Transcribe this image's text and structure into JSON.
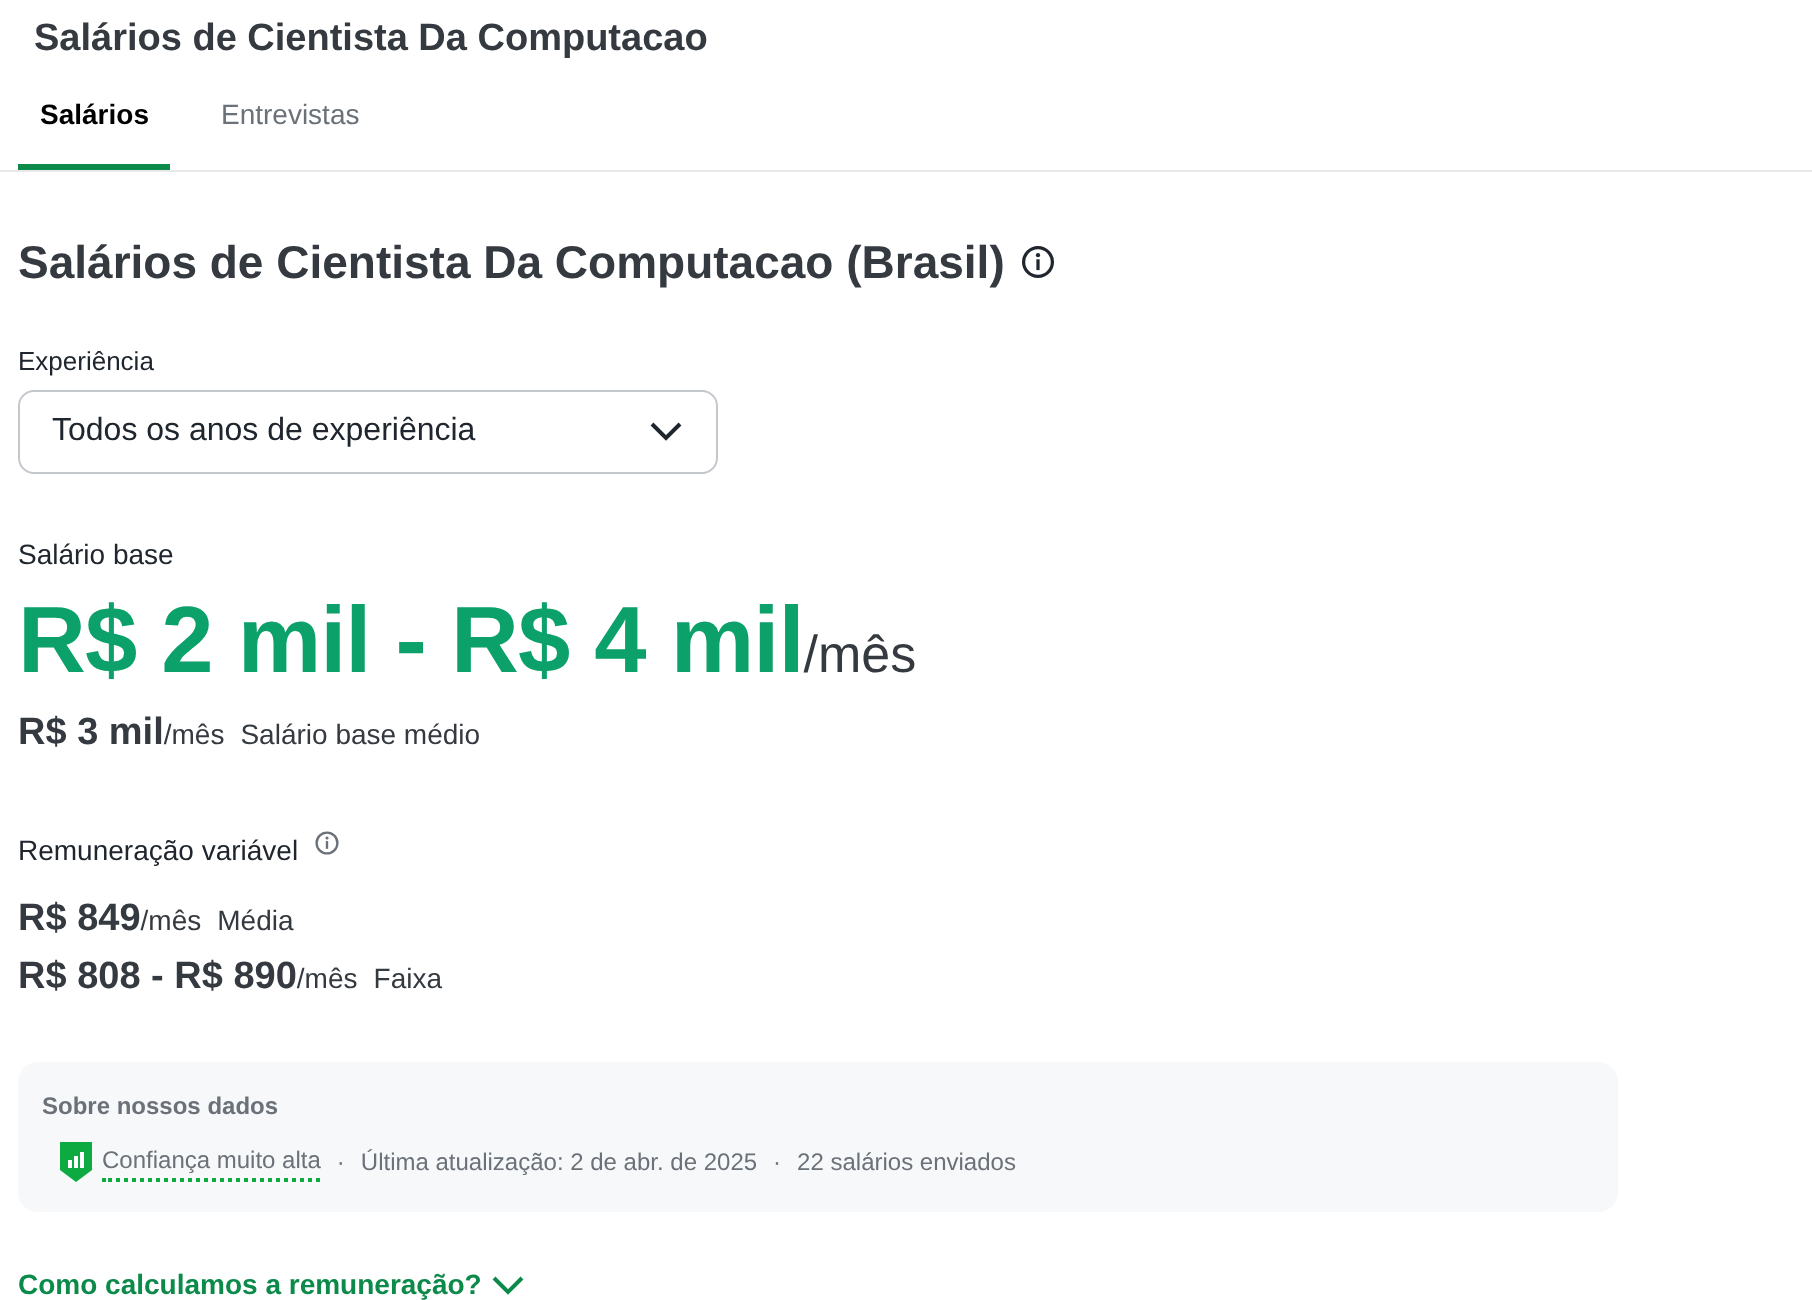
{
  "header": {
    "title": "Salários de Cientista Da Computacao"
  },
  "tabs": [
    {
      "label": "Salários",
      "selected": true
    },
    {
      "label": "Entrevistas",
      "selected": false
    }
  ],
  "heading": "Salários de Cientista Da Computacao (Brasil)",
  "experience": {
    "label": "Experiência",
    "value": "Todos os anos de experiência"
  },
  "base_salary": {
    "label": "Salário base",
    "range": "R$ 2 mil - R$ 4 mil",
    "unit": "/mês",
    "average": "R$ 3 mil",
    "average_unit": "/mês",
    "average_label": "Salário base médio"
  },
  "variable_pay": {
    "label": "Remuneração variável",
    "rows": [
      {
        "amount": "R$ 849",
        "unit": "/mês",
        "label": "Média"
      },
      {
        "amount": "R$ 808 - R$ 890",
        "unit": "/mês",
        "label": "Faixa"
      }
    ]
  },
  "about_data": {
    "title": "Sobre nossos dados",
    "confidence": "Confiança muito alta",
    "meta": [
      "·",
      "Última atualização: 2 de abr. de 2025",
      "·",
      "22 salários enviados"
    ]
  },
  "how_calculated": {
    "label": "Como calculamos a remuneração?",
    "expanded": false
  }
}
